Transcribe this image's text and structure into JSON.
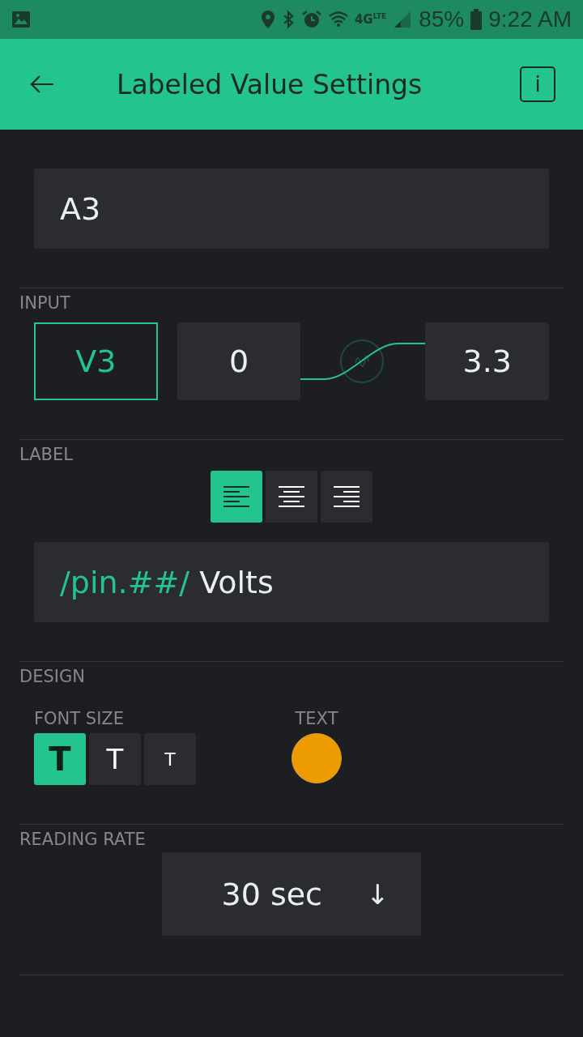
{
  "status_bar": {
    "network_type": "4G",
    "network_sub": "LTE",
    "battery": "85%",
    "time": "9:22 AM"
  },
  "header": {
    "title": "Labeled Value Settings",
    "info": "i"
  },
  "name_field": {
    "value": "A3"
  },
  "input": {
    "heading": "INPUT",
    "pin": "V3",
    "min": "0",
    "max": "3.3"
  },
  "label": {
    "heading": "LABEL",
    "alignments": [
      {
        "kind": "left",
        "selected": true
      },
      {
        "kind": "center",
        "selected": false
      },
      {
        "kind": "right",
        "selected": false
      }
    ],
    "parts": [
      {
        "kind": "template",
        "text": "/pin.##/"
      },
      {
        "kind": "plain",
        "text": " Volts"
      }
    ]
  },
  "design": {
    "heading": "DESIGN",
    "font_size_label": "FONT SIZE",
    "font_sizes": [
      {
        "kind": "large",
        "label": "T",
        "selected": true
      },
      {
        "kind": "medium",
        "label": "T",
        "selected": false
      },
      {
        "kind": "small",
        "label": "T",
        "selected": false
      }
    ],
    "text_color_label": "TEXT",
    "text_color": {
      "color": "#ec9c00"
    }
  },
  "reading_rate": {
    "heading": "READING RATE",
    "value": "30 sec",
    "arrow": "↓"
  }
}
